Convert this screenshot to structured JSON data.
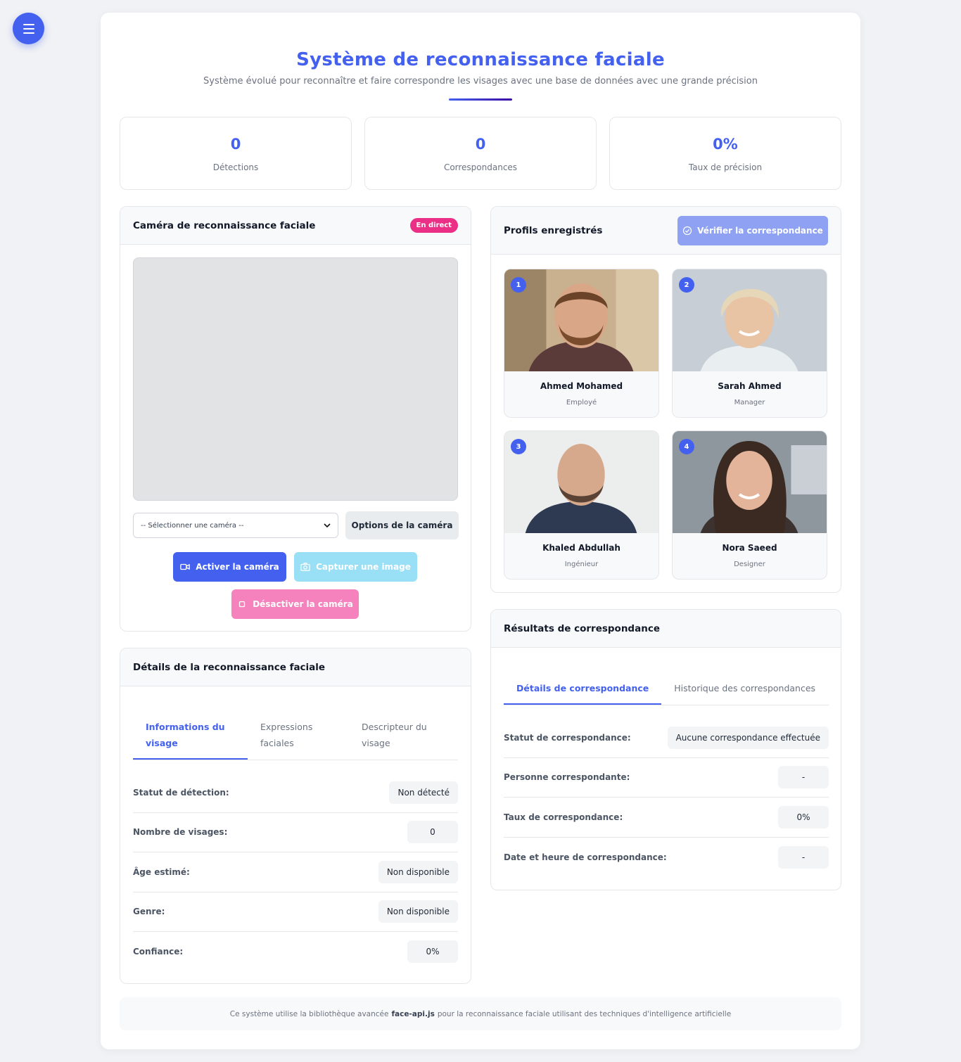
{
  "header": {
    "title": "Système de reconnaissance faciale",
    "subtitle": "Système évolué pour reconnaître et faire correspondre les visages avec une base de données avec une grande précision"
  },
  "stats": [
    {
      "value": "0",
      "label": "Détections"
    },
    {
      "value": "0",
      "label": "Correspondances"
    },
    {
      "value": "0%",
      "label": "Taux de précision"
    }
  ],
  "camera": {
    "title": "Caméra de reconnaissance faciale",
    "badge": "En direct",
    "select_placeholder": "-- Sélectionner une caméra --",
    "options_label": "Options de la caméra",
    "activate_label": "Activer la caméra",
    "capture_label": "Capturer une image",
    "deactivate_label": "Désactiver la caméra"
  },
  "details": {
    "title": "Détails de la reconnaissance faciale",
    "tabs": [
      {
        "label": "Informations du visage"
      },
      {
        "label": "Expressions faciales"
      },
      {
        "label": "Descripteur du visage"
      }
    ],
    "rows": [
      {
        "key": "Statut de détection:",
        "value": "Non détecté"
      },
      {
        "key": "Nombre de visages:",
        "value": "0"
      },
      {
        "key": "Âge estimé:",
        "value": "Non disponible"
      },
      {
        "key": "Genre:",
        "value": "Non disponible"
      },
      {
        "key": "Confiance:",
        "value": "0%"
      }
    ]
  },
  "profiles": {
    "title": "Profils enregistrés",
    "verify_label": "Vérifier la correspondance",
    "items": [
      {
        "number": "1",
        "name": "Ahmed Mohamed",
        "role": "Employé"
      },
      {
        "number": "2",
        "name": "Sarah Ahmed",
        "role": "Manager"
      },
      {
        "number": "3",
        "name": "Khaled Abdullah",
        "role": "Ingénieur"
      },
      {
        "number": "4",
        "name": "Nora Saeed",
        "role": "Designer"
      }
    ]
  },
  "results": {
    "title": "Résultats de correspondance",
    "tabs": [
      {
        "label": "Détails de correspondance"
      },
      {
        "label": "Historique des correspondances"
      }
    ],
    "rows": [
      {
        "key": "Statut de correspondance:",
        "value": "Aucune correspondance effectuée"
      },
      {
        "key": "Personne correspondante:",
        "value": "-"
      },
      {
        "key": "Taux de correspondance:",
        "value": "0%"
      },
      {
        "key": "Date et heure de correspondance:",
        "value": "-"
      }
    ]
  },
  "footer": {
    "text_before": "Ce système utilise la bibliothèque avancée",
    "library": "face-api.js",
    "text_after": "pour la reconnaissance faciale utilisant des techniques d'intelligence artificielle"
  },
  "colors": {
    "primary": "#4361ee",
    "live_badge": "#ec2f86",
    "capture": "#99dff5",
    "deactivate": "#f582bc"
  },
  "icons": [
    "menu-icon",
    "video-camera-icon",
    "camera-icon",
    "stop-icon",
    "check-circle-icon",
    "chevron-down-icon"
  ]
}
